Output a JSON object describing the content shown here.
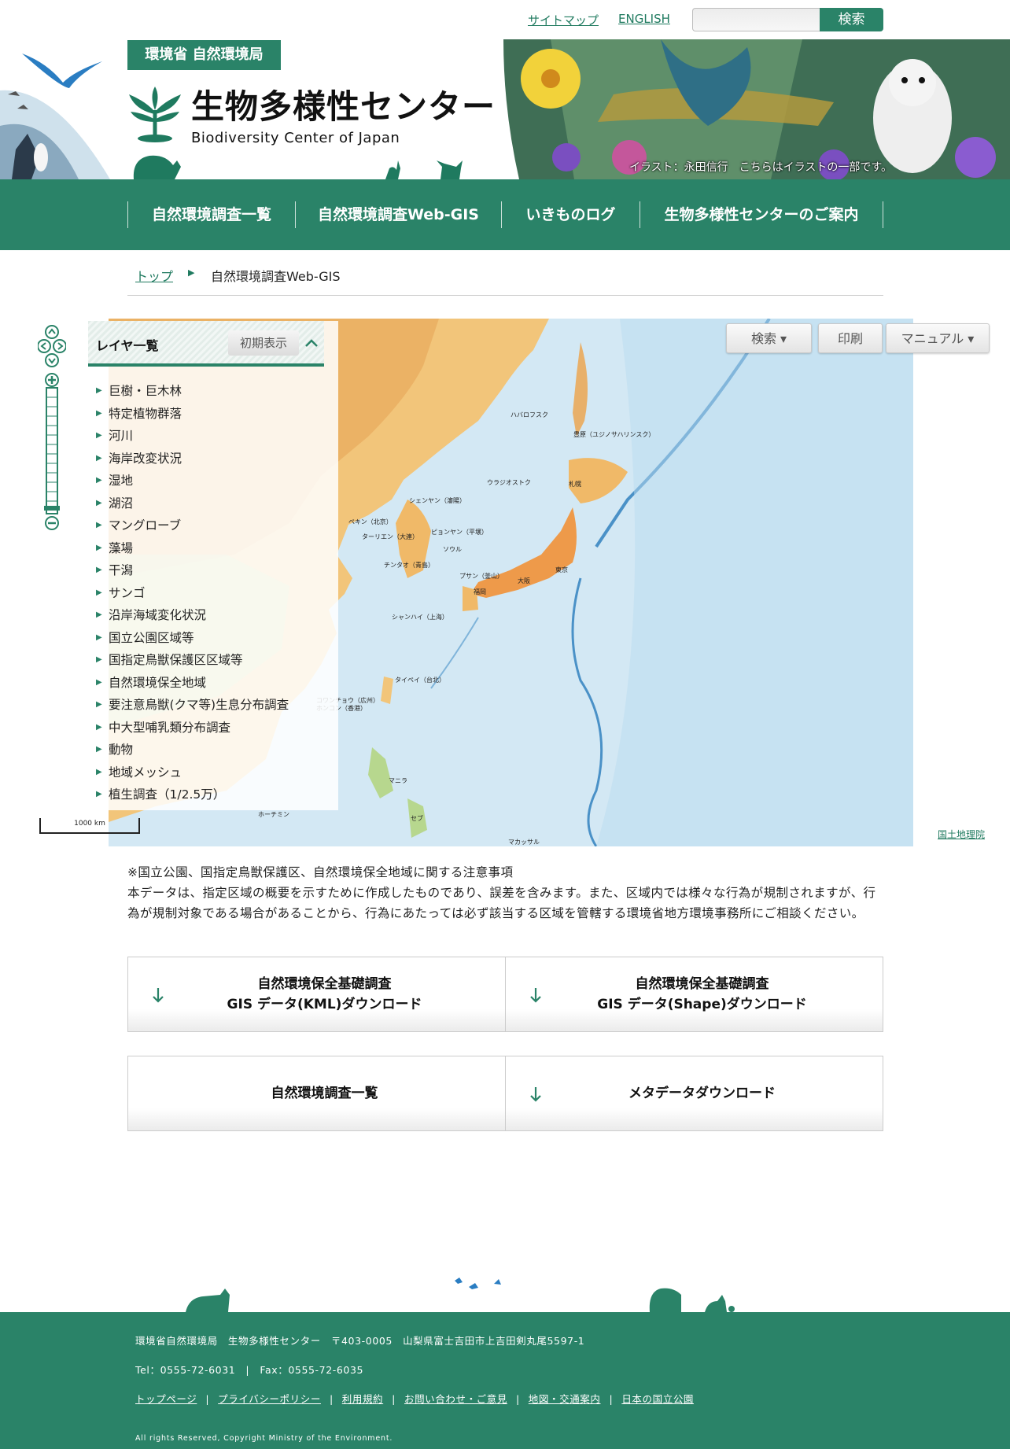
{
  "topbar": {
    "sitemap": "サイトマップ",
    "english": "ENGLISH",
    "search_placeholder": "",
    "search_button": "検索"
  },
  "header": {
    "ministry_badge": "環境省 自然環境局",
    "title": "生物多様性センター",
    "subtitle": "Biodiversity Center of Japan",
    "illustration_credit": "イラスト：永田信行　こちらはイラストの一部です。"
  },
  "nav": {
    "items": [
      {
        "label": "自然環境調査一覧"
      },
      {
        "label": "自然環境調査Web-GIS"
      },
      {
        "label": "いきものログ"
      },
      {
        "label": "生物多様性センターのご案内"
      }
    ]
  },
  "breadcrumb": {
    "top": "トップ",
    "current": "自然環境調査Web-GIS"
  },
  "map": {
    "search_button": "検索 ▾",
    "print_button": "印刷",
    "manual_button": "マニュアル ▾",
    "scale_label": "1000 km",
    "attribution": "国土地理院",
    "cities": [
      "ハバロフスク",
      "豊原（ユジノサハリンスク）",
      "ウラジオストク",
      "札幌",
      "シェンヤン（瀋陽）",
      "ペキン（北京）",
      "ピョンヤン（平壌）",
      "ターリエン（大連）",
      "ソウル",
      "チンタオ（青島）",
      "プサン（釜山）",
      "大阪",
      "東京",
      "福岡",
      "シャンハイ（上海）",
      "タイペイ（台北）",
      "コワンチョウ（広州）",
      "ホンコン（香港）",
      "マニラ",
      "セブ",
      "ホーチミン",
      "マカッサル"
    ]
  },
  "layer_panel": {
    "title": "レイヤ一覧",
    "reset_button": "初期表示",
    "layers": [
      "巨樹・巨木林",
      "特定植物群落",
      "河川",
      "海岸改変状況",
      "湿地",
      "湖沼",
      "マングローブ",
      "藻場",
      "干潟",
      "サンゴ",
      "沿岸海域変化状況",
      "国立公園区域等",
      "国指定鳥獣保護区区域等",
      "自然環境保全地域",
      "要注意鳥獣(クマ等)生息分布調査",
      "中大型哺乳類分布調査",
      "動物",
      "地域メッシュ",
      "植生調査（1/2.5万）"
    ]
  },
  "notice": {
    "heading": "※国立公園、国指定鳥獣保護区、自然環境保全地域に関する注意事項",
    "body": "本データは、指定区域の概要を示すために作成したものであり、誤差を含みます。また、区域内では様々な行為が規制されますが、行為が規制対象である場合があることから、行為にあたっては必ず該当する区域を管轄する環境省地方環境事務所にご相談ください。"
  },
  "downloads": {
    "kml_line1": "自然環境保全基礎調査",
    "kml_line2": "GIS データ(KML)ダウンロード",
    "shape_line1": "自然環境保全基礎調査",
    "shape_line2": "GIS データ(Shape)ダウンロード",
    "survey_list": "自然環境調査一覧",
    "metadata": "メタデータダウンロード"
  },
  "footer": {
    "address": "環境省自然環境局　生物多様性センター　〒403-0005　山梨県富士吉田市上吉田剣丸尾5597-1",
    "contact": "Tel：0555-72-6031　|　Fax：0555-72-6035",
    "links": [
      "トップページ",
      "プライバシーポリシー",
      "利用規約",
      "お問い合わせ・ご意見",
      "地図・交通案内",
      "日本の国立公園"
    ],
    "copyright": "All rights Reserved, Copyright Ministry of the Environment."
  },
  "colors": {
    "brand_green": "#2a8368",
    "link_green": "#1f7a5f",
    "sea_blue": "#d9ecf6",
    "land_tan": "#f2c57a"
  }
}
